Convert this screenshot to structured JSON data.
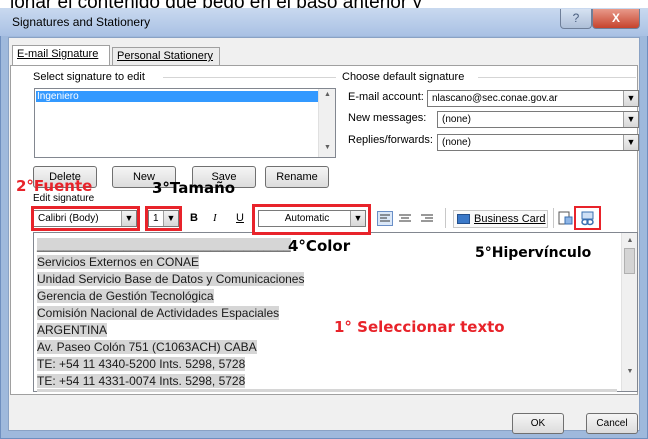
{
  "header_caption": "ionar el contenido que pegó en el paso anterior y",
  "window": {
    "title": "Signatures and Stationery",
    "help_label": "?",
    "close_label": "X"
  },
  "tabs": [
    {
      "label": "E-mail Signature",
      "active": true
    },
    {
      "label": "Personal Stationery",
      "active": false
    }
  ],
  "select_signature": {
    "label": "Select signature to edit",
    "items": [
      "Ingeniero"
    ],
    "selected": "Ingeniero"
  },
  "signature_buttons": {
    "delete": "Delete",
    "new": "New",
    "save": "Save",
    "rename": "Rename"
  },
  "default_signature": {
    "label": "Choose default signature",
    "email_account_label": "E-mail account:",
    "email_account_value": "nlascano@sec.conae.gov.ar",
    "new_messages_label": "New messages:",
    "new_messages_value": "(none)",
    "replies_label": "Replies/forwards:",
    "replies_value": "(none)"
  },
  "edit_signature": {
    "label": "Edit signature"
  },
  "toolbar": {
    "font": "Calibri (Body)",
    "size": "1",
    "bold": "B",
    "italic": "I",
    "underline": "U",
    "color": "Automatic",
    "business_card": "Business Card"
  },
  "signature_text": {
    "rule": "______________________________________",
    "lines": [
      "Servicios Externos en CONAE",
      "Unidad Servicio Base de Datos y Comunicaciones",
      "Gerencia de Gestión Tecnológica",
      "Comisión Nacional de Actividades Espaciales",
      "ARGENTINA",
      "Av. Paseo Colón 751  (C1063ACH) CABA",
      "TE: +54 11 4340-5200  Ints. 5298, 5728",
      "TE: +54 11 4331-0074  Ints. 5298, 5728"
    ]
  },
  "annotations": {
    "font": "2°Fuente",
    "size": "3°Tamaño",
    "color": "4°Color",
    "hyperlink": "5°Hipervínculo",
    "select_text": "1° Seleccionar texto"
  },
  "dialog_buttons": {
    "ok": "OK",
    "cancel": "Cancel"
  },
  "colors": {
    "annotation": "#e8232a",
    "selection": "#3399ff",
    "text_highlight": "#d6d6d6"
  }
}
